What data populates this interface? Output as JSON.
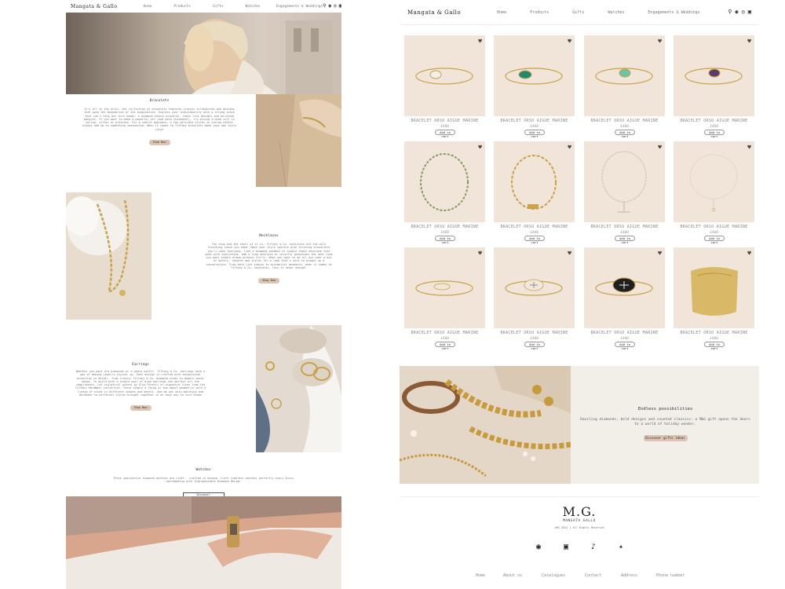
{
  "brand": "Mangata & Gallo",
  "nav": [
    "Home",
    "Products",
    "Gifts",
    "Watches",
    "Engagements & Weddings"
  ],
  "header_icons": [
    "search-icon",
    "account-icon",
    "settings-icon",
    "cart-icon"
  ],
  "left": {
    "bracelets": {
      "title": "Bracelets",
      "body": "It's all in the wrist. Our collection of bracelets features classic silhouettes and designs that push the boundaries of the imagination. Express your individuality with a strong stack that can't help but turn heads: a diamond tennis bracelet, chain link designs and polished bangles. If you want to make a powerful yet (and bold statement), try mixing & wide cuff in yellow, silver or precious. For a subtle approach, a few delicate styles in narrow widths always add up to something unexpected. When it comes to Tiffany bracelets make your own style rules",
      "cta": "Shop Now"
    },
    "necklaces": {
      "title": "Necklaces",
      "body": "The long and the short of it is, Tiffany & Co. necklaces are the only finishing touch you need. Make your style sparkle with striking essentials you'll wear everyday, like a diamond pendant or simple chain necklace that goes with everything. Add a long necklace or colorful gemstones the next time you want simple drama without frills. When you want to go all out wear a mix of metals, lengths and styles for a look that's sure to prompt up a conversation. From bold link chains to minimalist pendants, when it comes to Tiffany & Co. necklaces, less is never enough.",
      "cta": "Shop Now"
    },
    "earrings": {
      "title": "Earrings",
      "body": "Whether you want old diamonds or a whole outfit, Tiffany & Co. earrings have a way of making jewelry jazzier up. Each design is crafted with exceptional attention to detail, from classic Tiffany & Co. diamond studs to modern metal hoops. To build with a single pair of drop earrings the perfect all the compliments. Let sculptural pieces by Elsa Peretti or signature lines from the Tiffany HardWear collection. There simply a thing or two about geometric with a lineup of studs in different shapes and metals. And do not miss matching and Hardwear-to-different styles brought together is an easy way to turn heads",
      "cta": "Shop Now"
    },
    "watches": {
      "title": "Watches",
      "body": "These spectacular diamond watches are craft - crafted in Geneva. Craft timeless watches perfectly every Swiss watchmaking with Indispensable Diamond Design",
      "cta": "Discover"
    }
  },
  "products": [
    {
      "name": "BRACELET ORSO AIGUE MARINE",
      "price": "£400",
      "cta": "Add to cart",
      "kind": "bangle-pearl"
    },
    {
      "name": "BRACELET ORSO AIGUE MARINE",
      "price": "£400",
      "cta": "Add to cart",
      "kind": "bangle-green"
    },
    {
      "name": "BRACELET ORSO AIGUE MARINE",
      "price": "£400",
      "cta": "Add to cart",
      "kind": "bangle-turq"
    },
    {
      "name": "BRACELET ORSO AIGUE MARINE",
      "price": "£400",
      "cta": "Add to cart",
      "kind": "bangle-purple"
    },
    {
      "name": "BRACELET ORSO AIGUE MARINE",
      "price": "£400",
      "cta": "Add to cart",
      "kind": "beads"
    },
    {
      "name": "BRACELET ORSO AIGUE MARINE",
      "price": "£400",
      "cta": "Add to cart",
      "kind": "chain-gold"
    },
    {
      "name": "BRACELET ORSO AIGUE MARINE",
      "price": "£400",
      "cta": "Add to cart",
      "kind": "toggle"
    },
    {
      "name": "BRACELET ORSO AIGUE MARINE",
      "price": "£400",
      "cta": "Add to cart",
      "kind": "drop"
    },
    {
      "name": "BRACELET ORSO AIGUE MARINE",
      "price": "£400",
      "cta": "Add to cart",
      "kind": "cuff-thin"
    },
    {
      "name": "BRACELET ORSO AIGUE MARINE",
      "price": "£400",
      "cta": "Add to cart",
      "kind": "cross"
    },
    {
      "name": "BRACELET ORSO AIGUE MARINE",
      "price": "£400",
      "cta": "Add to cart",
      "kind": "onyx"
    },
    {
      "name": "BRACELET ORSO AIGUE MARINE",
      "price": "£400",
      "cta": "Add to cart",
      "kind": "wide-cuff"
    }
  ],
  "promo": {
    "title": "Endless possibilities",
    "body": "Dazzling diamonds, bold designs and coveted classics: a M&G gift opens the doors to a world of holiday wonder.",
    "cta": "Discover gifts ideas"
  },
  "footer": {
    "monogram": "M.G.",
    "brand": "MANGATA GALLO",
    "copyright": "©MG 2023 | All Rights Reserved",
    "social": [
      "facebook-icon",
      "instagram-icon",
      "tiktok-icon",
      "twitter-icon"
    ],
    "links": [
      "Home",
      "About us",
      "Catalogues",
      "Contact",
      "Address",
      "Phone number"
    ]
  },
  "colors": {
    "accent": "#dcc5b4",
    "product_bg": "#f1e5da",
    "promo_bg": "#f1efe8",
    "gold": "#c9a24a"
  }
}
